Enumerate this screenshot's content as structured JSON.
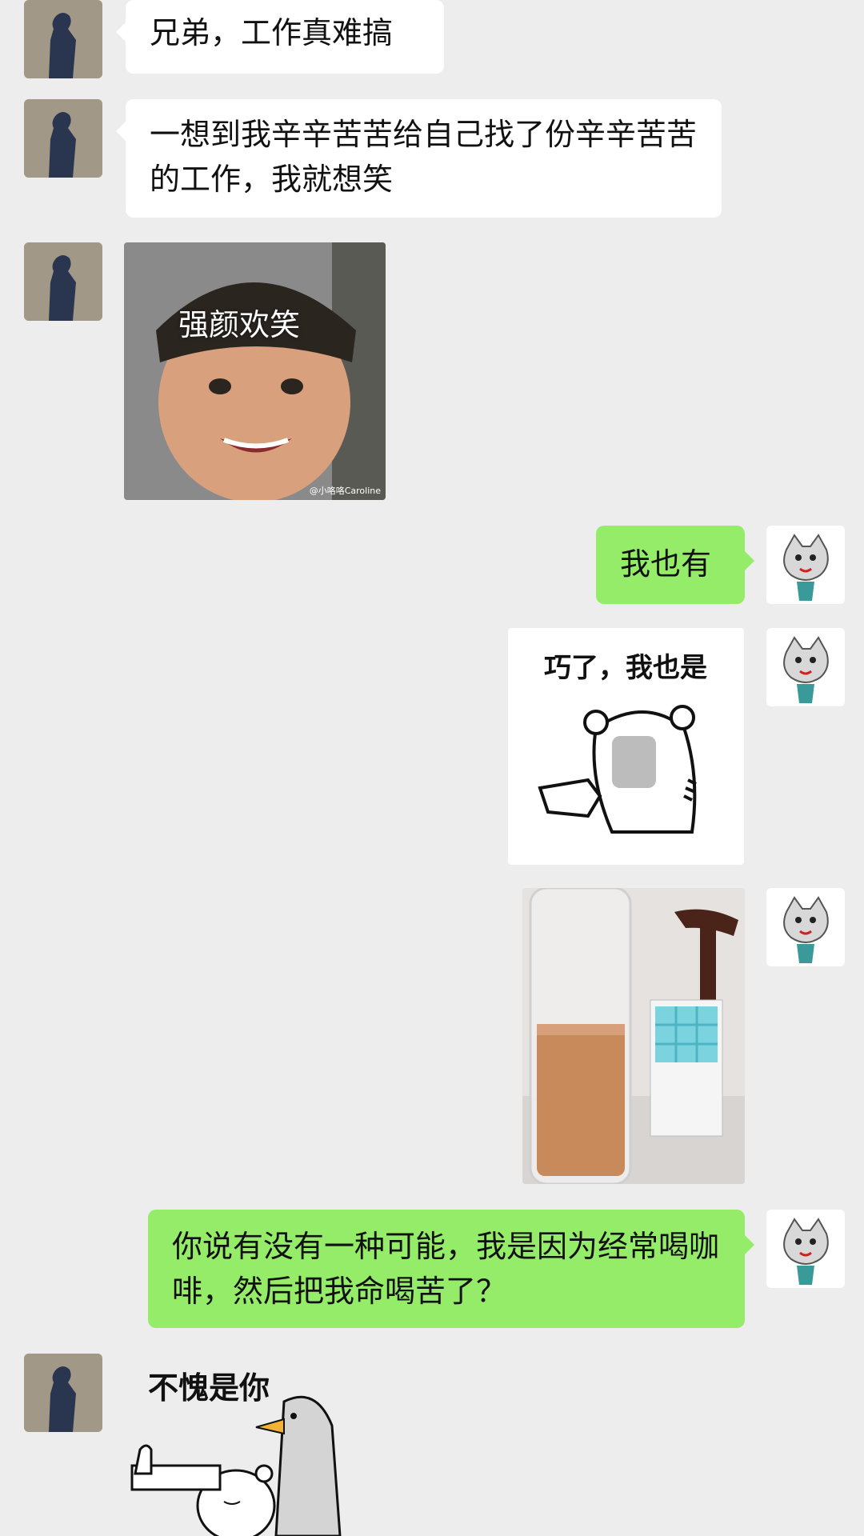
{
  "messages": [
    {
      "id": "m1",
      "side": "in",
      "type": "text",
      "text": "兄弟，工作真难搞"
    },
    {
      "id": "m2",
      "side": "in",
      "type": "text",
      "text": "一想到我辛辛苦苦给自己找了份辛辛苦苦的工作，我就想笑"
    },
    {
      "id": "m3",
      "side": "in",
      "type": "image",
      "overlay_text": "强颜欢笑",
      "watermark": "@小咯咯Caroline"
    },
    {
      "id": "m4",
      "side": "out",
      "type": "text",
      "text": "我也有"
    },
    {
      "id": "m5",
      "side": "out",
      "type": "sticker",
      "caption": "巧了，我也是"
    },
    {
      "id": "m6",
      "side": "out",
      "type": "photo"
    },
    {
      "id": "m7",
      "side": "out",
      "type": "text",
      "text": "你说有没有一种可能，我是因为经常喝咖啡，然后把我命喝苦了？"
    },
    {
      "id": "m8",
      "side": "in",
      "type": "sticker",
      "caption": "不愧是你"
    }
  ],
  "colors": {
    "background": "#ededed",
    "incoming_bubble": "#ffffff",
    "outgoing_bubble": "#95ec69"
  }
}
